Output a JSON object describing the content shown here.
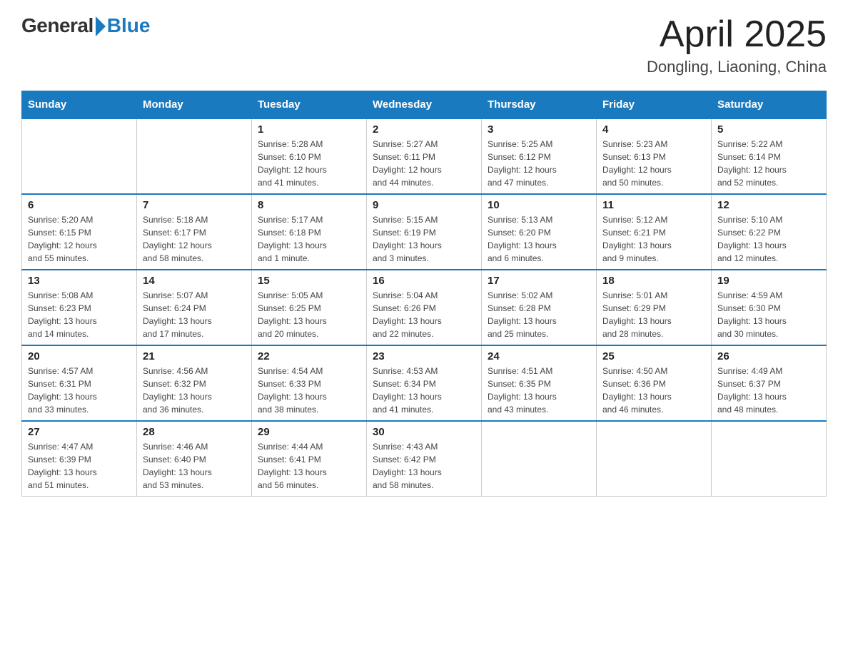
{
  "logo": {
    "general": "General",
    "blue": "Blue"
  },
  "title": "April 2025",
  "subtitle": "Dongling, Liaoning, China",
  "headers": [
    "Sunday",
    "Monday",
    "Tuesday",
    "Wednesday",
    "Thursday",
    "Friday",
    "Saturday"
  ],
  "weeks": [
    [
      {
        "day": "",
        "info": ""
      },
      {
        "day": "",
        "info": ""
      },
      {
        "day": "1",
        "info": "Sunrise: 5:28 AM\nSunset: 6:10 PM\nDaylight: 12 hours\nand 41 minutes."
      },
      {
        "day": "2",
        "info": "Sunrise: 5:27 AM\nSunset: 6:11 PM\nDaylight: 12 hours\nand 44 minutes."
      },
      {
        "day": "3",
        "info": "Sunrise: 5:25 AM\nSunset: 6:12 PM\nDaylight: 12 hours\nand 47 minutes."
      },
      {
        "day": "4",
        "info": "Sunrise: 5:23 AM\nSunset: 6:13 PM\nDaylight: 12 hours\nand 50 minutes."
      },
      {
        "day": "5",
        "info": "Sunrise: 5:22 AM\nSunset: 6:14 PM\nDaylight: 12 hours\nand 52 minutes."
      }
    ],
    [
      {
        "day": "6",
        "info": "Sunrise: 5:20 AM\nSunset: 6:15 PM\nDaylight: 12 hours\nand 55 minutes."
      },
      {
        "day": "7",
        "info": "Sunrise: 5:18 AM\nSunset: 6:17 PM\nDaylight: 12 hours\nand 58 minutes."
      },
      {
        "day": "8",
        "info": "Sunrise: 5:17 AM\nSunset: 6:18 PM\nDaylight: 13 hours\nand 1 minute."
      },
      {
        "day": "9",
        "info": "Sunrise: 5:15 AM\nSunset: 6:19 PM\nDaylight: 13 hours\nand 3 minutes."
      },
      {
        "day": "10",
        "info": "Sunrise: 5:13 AM\nSunset: 6:20 PM\nDaylight: 13 hours\nand 6 minutes."
      },
      {
        "day": "11",
        "info": "Sunrise: 5:12 AM\nSunset: 6:21 PM\nDaylight: 13 hours\nand 9 minutes."
      },
      {
        "day": "12",
        "info": "Sunrise: 5:10 AM\nSunset: 6:22 PM\nDaylight: 13 hours\nand 12 minutes."
      }
    ],
    [
      {
        "day": "13",
        "info": "Sunrise: 5:08 AM\nSunset: 6:23 PM\nDaylight: 13 hours\nand 14 minutes."
      },
      {
        "day": "14",
        "info": "Sunrise: 5:07 AM\nSunset: 6:24 PM\nDaylight: 13 hours\nand 17 minutes."
      },
      {
        "day": "15",
        "info": "Sunrise: 5:05 AM\nSunset: 6:25 PM\nDaylight: 13 hours\nand 20 minutes."
      },
      {
        "day": "16",
        "info": "Sunrise: 5:04 AM\nSunset: 6:26 PM\nDaylight: 13 hours\nand 22 minutes."
      },
      {
        "day": "17",
        "info": "Sunrise: 5:02 AM\nSunset: 6:28 PM\nDaylight: 13 hours\nand 25 minutes."
      },
      {
        "day": "18",
        "info": "Sunrise: 5:01 AM\nSunset: 6:29 PM\nDaylight: 13 hours\nand 28 minutes."
      },
      {
        "day": "19",
        "info": "Sunrise: 4:59 AM\nSunset: 6:30 PM\nDaylight: 13 hours\nand 30 minutes."
      }
    ],
    [
      {
        "day": "20",
        "info": "Sunrise: 4:57 AM\nSunset: 6:31 PM\nDaylight: 13 hours\nand 33 minutes."
      },
      {
        "day": "21",
        "info": "Sunrise: 4:56 AM\nSunset: 6:32 PM\nDaylight: 13 hours\nand 36 minutes."
      },
      {
        "day": "22",
        "info": "Sunrise: 4:54 AM\nSunset: 6:33 PM\nDaylight: 13 hours\nand 38 minutes."
      },
      {
        "day": "23",
        "info": "Sunrise: 4:53 AM\nSunset: 6:34 PM\nDaylight: 13 hours\nand 41 minutes."
      },
      {
        "day": "24",
        "info": "Sunrise: 4:51 AM\nSunset: 6:35 PM\nDaylight: 13 hours\nand 43 minutes."
      },
      {
        "day": "25",
        "info": "Sunrise: 4:50 AM\nSunset: 6:36 PM\nDaylight: 13 hours\nand 46 minutes."
      },
      {
        "day": "26",
        "info": "Sunrise: 4:49 AM\nSunset: 6:37 PM\nDaylight: 13 hours\nand 48 minutes."
      }
    ],
    [
      {
        "day": "27",
        "info": "Sunrise: 4:47 AM\nSunset: 6:39 PM\nDaylight: 13 hours\nand 51 minutes."
      },
      {
        "day": "28",
        "info": "Sunrise: 4:46 AM\nSunset: 6:40 PM\nDaylight: 13 hours\nand 53 minutes."
      },
      {
        "day": "29",
        "info": "Sunrise: 4:44 AM\nSunset: 6:41 PM\nDaylight: 13 hours\nand 56 minutes."
      },
      {
        "day": "30",
        "info": "Sunrise: 4:43 AM\nSunset: 6:42 PM\nDaylight: 13 hours\nand 58 minutes."
      },
      {
        "day": "",
        "info": ""
      },
      {
        "day": "",
        "info": ""
      },
      {
        "day": "",
        "info": ""
      }
    ]
  ]
}
